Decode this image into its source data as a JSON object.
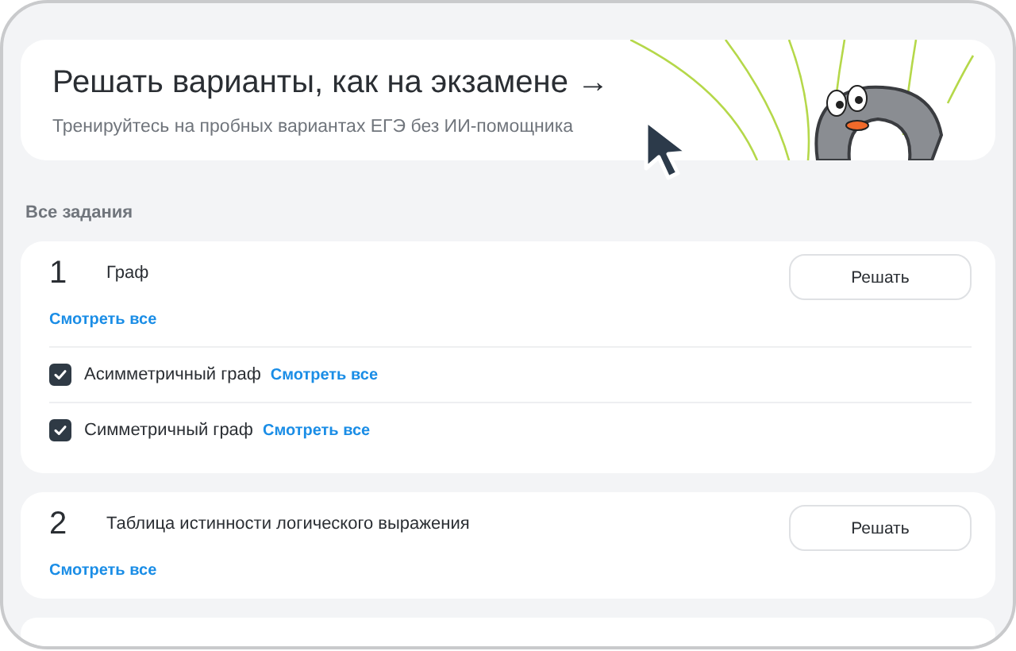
{
  "banner": {
    "title": "Решать варианты, как на экзамене →",
    "subtitle": "Тренируйтесь на пробных вариантах ЕГЭ без ИИ-помощника"
  },
  "section_title": "Все задания",
  "tasks": [
    {
      "number": "1",
      "title": "Граф",
      "link": "Смотреть все",
      "button": "Решать",
      "subtopics": [
        {
          "label": "Асимметричный граф",
          "checked": true,
          "link": "Смотреть все"
        },
        {
          "label": "Симметричный граф",
          "checked": true,
          "link": "Смотреть все"
        }
      ]
    },
    {
      "number": "2",
      "title": "Таблица истинности логического выражения",
      "link": "Смотреть все",
      "button": "Решать"
    }
  ]
}
